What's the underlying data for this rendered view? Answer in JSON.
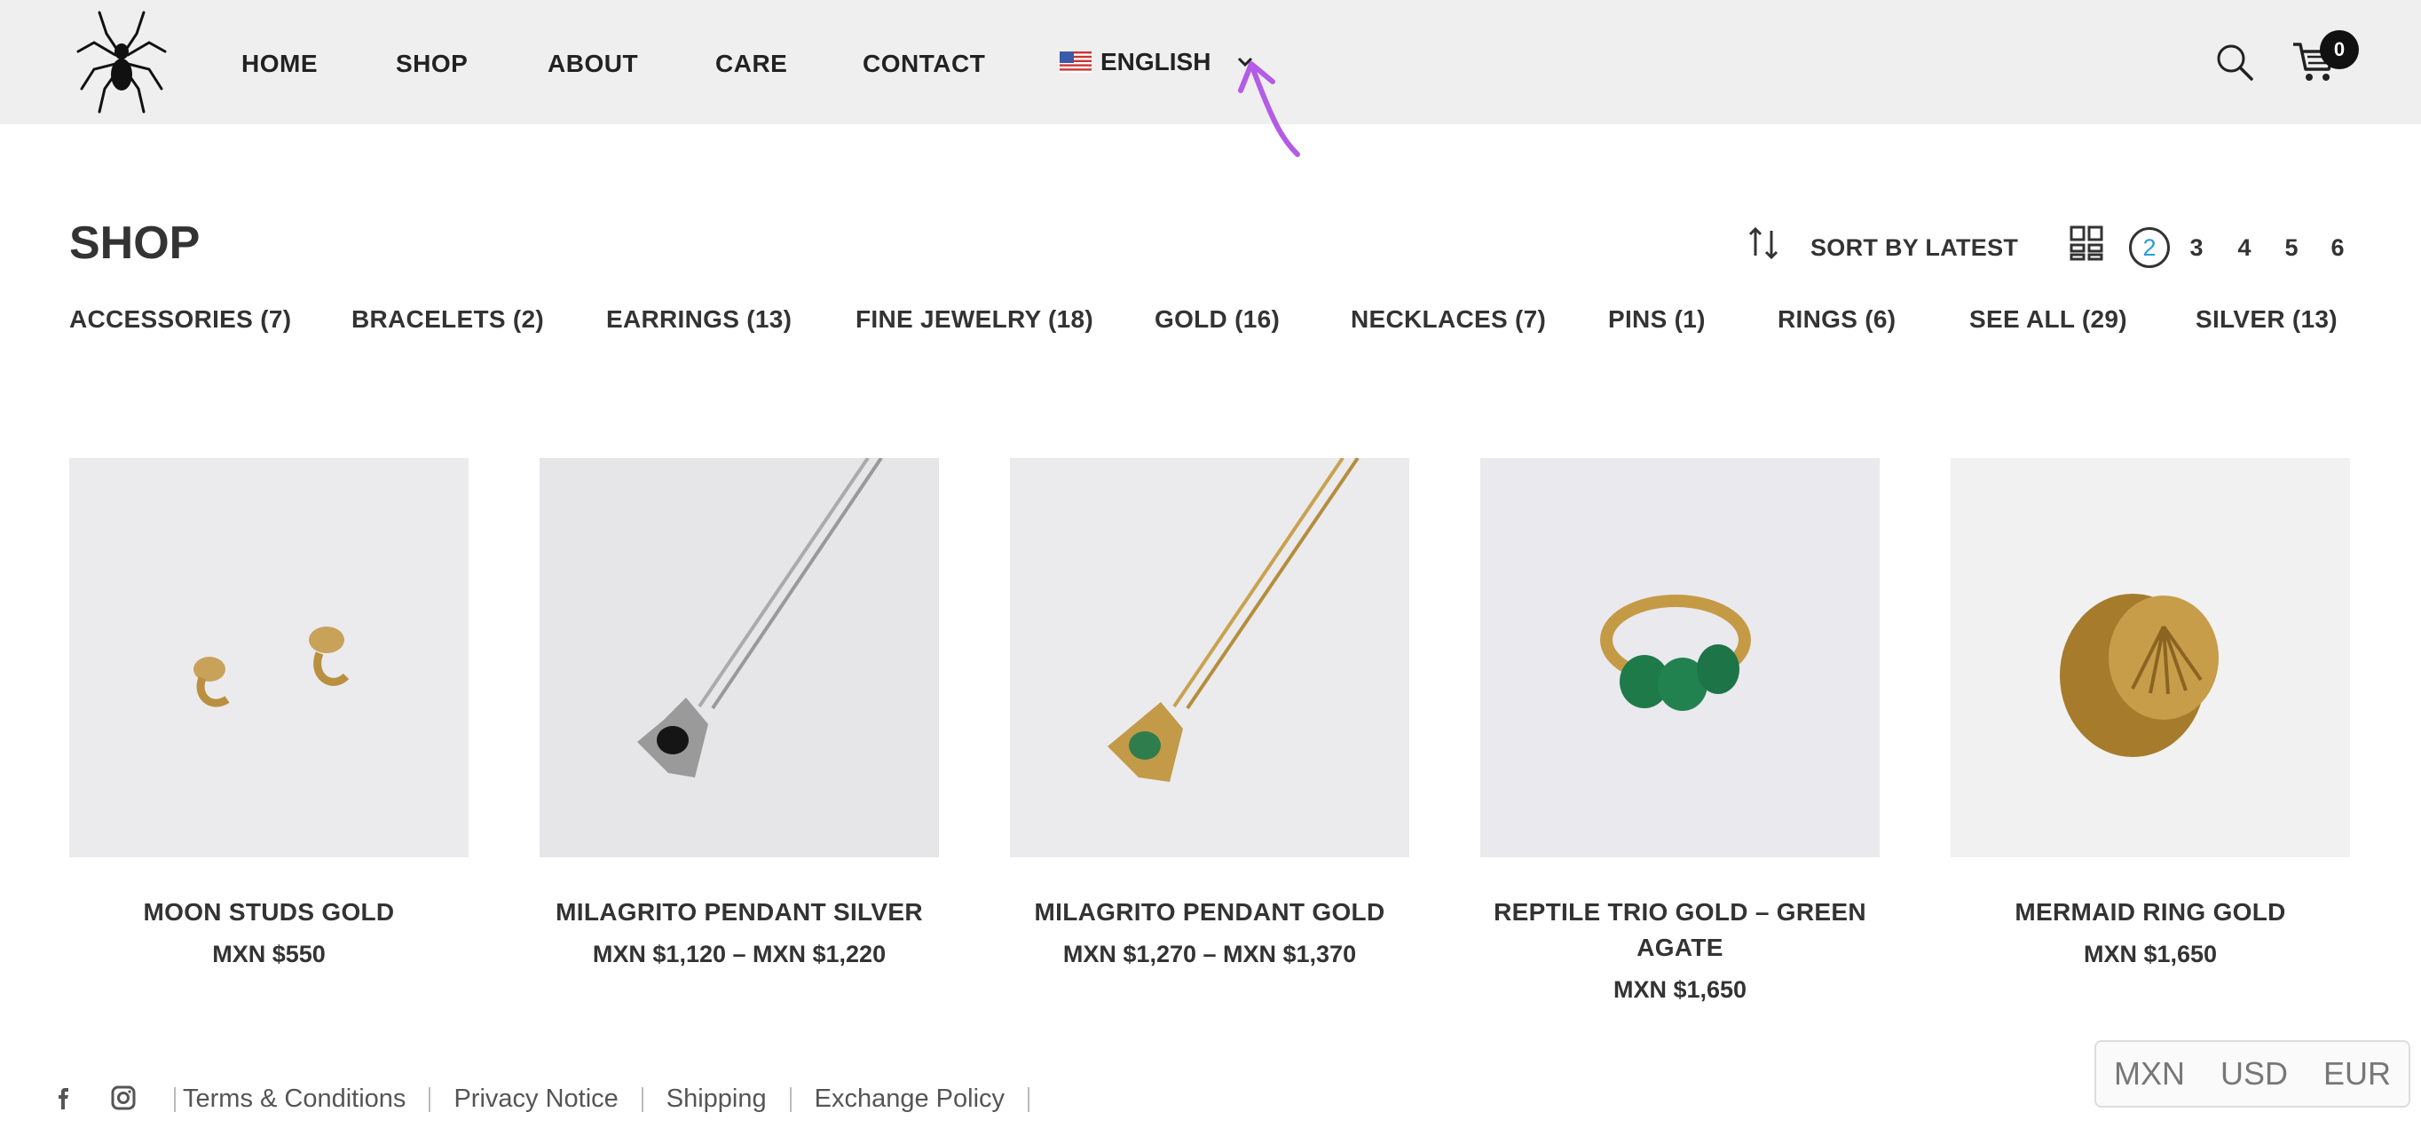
{
  "header": {
    "nav": [
      "HOME",
      "SHOP",
      "ABOUT",
      "CARE",
      "CONTACT"
    ],
    "language": "ENGLISH",
    "cart_count": "0",
    "icons": [
      "spider-logo-icon",
      "us-flag-icon",
      "chevron-down-icon",
      "search-icon",
      "cart-icon"
    ]
  },
  "shop": {
    "title": "SHOP",
    "sort_label": "SORT BY LATEST",
    "grid_options": [
      "2",
      "3",
      "4",
      "5",
      "6"
    ],
    "active_grid": "2",
    "categories": [
      "ACCESSORIES (7)",
      "BRACELETS (2)",
      "EARRINGS (13)",
      "FINE JEWELRY (18)",
      "GOLD (16)",
      "NECKLACES (7)",
      "PINS (1)",
      "RINGS (6)",
      "SEE ALL (29)",
      "SILVER (13)"
    ]
  },
  "products": [
    {
      "name": "MOON STUDS GOLD",
      "price": "MXN $550"
    },
    {
      "name": "MILAGRITO PENDANT SILVER",
      "price": "MXN $1,120 – MXN $1,220"
    },
    {
      "name": "MILAGRITO PENDANT GOLD",
      "price": "MXN $1,270 – MXN $1,370"
    },
    {
      "name": "REPTILE TRIO GOLD – GREEN AGATE",
      "price": "MXN $1,650"
    },
    {
      "name": "MERMAID RING GOLD",
      "price": "MXN $1,650"
    }
  ],
  "footer": {
    "links": [
      "Terms & Conditions",
      "Privacy Notice",
      "Shipping",
      "Exchange Policy"
    ],
    "social": [
      "facebook-icon",
      "instagram-icon"
    ],
    "currencies": [
      "MXN",
      "USD",
      "EUR"
    ]
  },
  "colors": {
    "header_bg": "#efefef",
    "annotation": "#b35ce6",
    "active_grid": "#2b9bd8"
  }
}
